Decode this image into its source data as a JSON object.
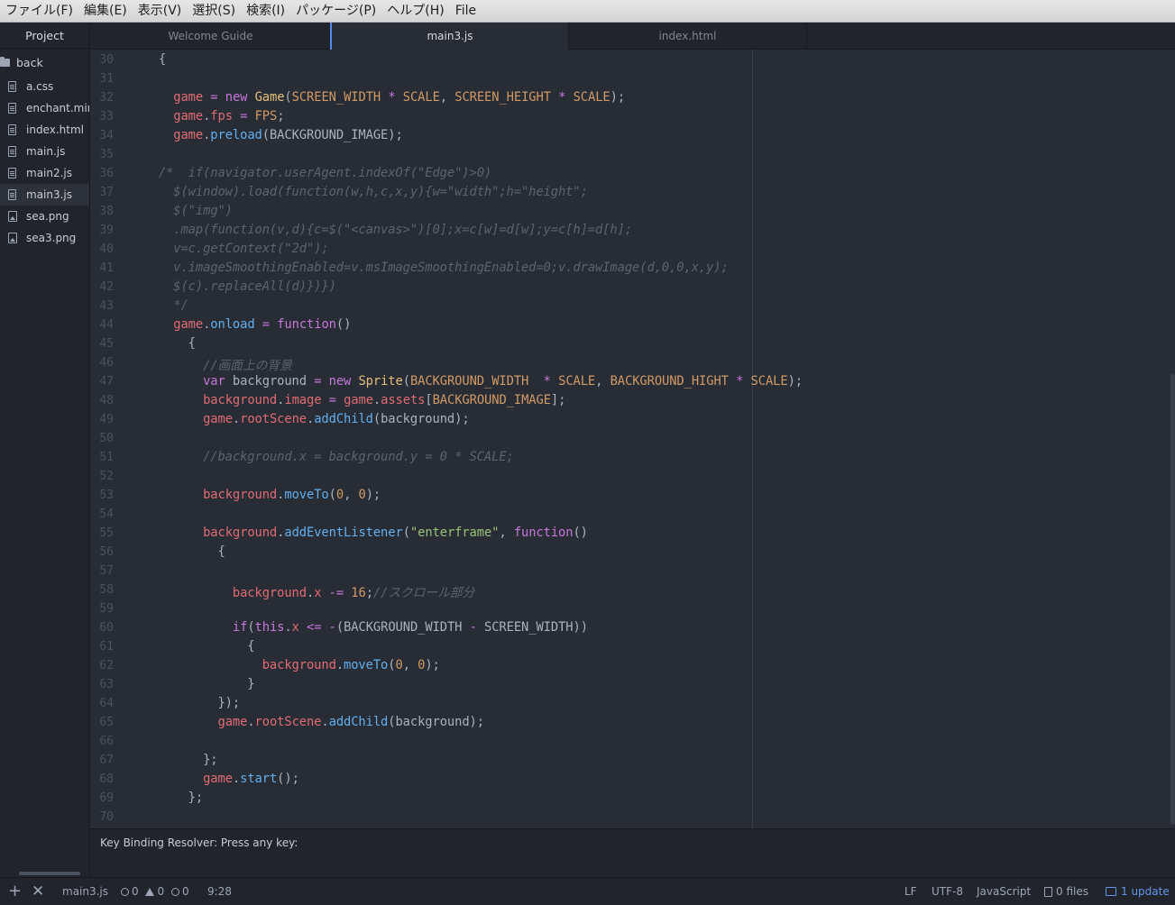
{
  "menu": [
    "ファイル(F)",
    "編集(E)",
    "表示(V)",
    "選択(S)",
    "検索(I)",
    "パッケージ(P)",
    "ヘルプ(H)",
    "File"
  ],
  "sidebar": {
    "title": "Project",
    "root": "back",
    "files": [
      {
        "name": "a.css",
        "type": "file"
      },
      {
        "name": "enchant.min.js",
        "type": "file"
      },
      {
        "name": "index.html",
        "type": "file"
      },
      {
        "name": "main.js",
        "type": "file"
      },
      {
        "name": "main2.js",
        "type": "file"
      },
      {
        "name": "main3.js",
        "type": "file",
        "selected": true
      },
      {
        "name": "sea.png",
        "type": "image"
      },
      {
        "name": "sea3.png",
        "type": "image"
      }
    ]
  },
  "tabs": [
    {
      "label": "Welcome Guide",
      "active": false
    },
    {
      "label": "main3.js",
      "active": true
    },
    {
      "label": "index.html",
      "active": false
    }
  ],
  "editor": {
    "lines": [
      {
        "n": "30",
        "tokens": [
          [
            "p",
            "    {"
          ]
        ]
      },
      {
        "n": "31",
        "tokens": []
      },
      {
        "n": "32",
        "tokens": [
          [
            "p",
            "      "
          ],
          [
            "v",
            "game"
          ],
          [
            "p",
            " "
          ],
          [
            "o",
            "="
          ],
          [
            "p",
            " "
          ],
          [
            "k",
            "new"
          ],
          [
            "p",
            " "
          ],
          [
            "t",
            "Game"
          ],
          [
            "p",
            "("
          ],
          [
            "c",
            "SCREEN_WIDTH"
          ],
          [
            "p",
            " "
          ],
          [
            "o",
            "*"
          ],
          [
            "p",
            " "
          ],
          [
            "c",
            "SCALE"
          ],
          [
            "p",
            ", "
          ],
          [
            "c",
            "SCREEN_HEIGHT"
          ],
          [
            "p",
            " "
          ],
          [
            "o",
            "*"
          ],
          [
            "p",
            " "
          ],
          [
            "c",
            "SCALE"
          ],
          [
            "p",
            ");"
          ]
        ]
      },
      {
        "n": "33",
        "tokens": [
          [
            "p",
            "      "
          ],
          [
            "v",
            "game"
          ],
          [
            "p",
            "."
          ],
          [
            "v",
            "fps"
          ],
          [
            "p",
            " "
          ],
          [
            "o",
            "="
          ],
          [
            "p",
            " "
          ],
          [
            "c",
            "FPS"
          ],
          [
            "p",
            ";"
          ]
        ]
      },
      {
        "n": "34",
        "tokens": [
          [
            "p",
            "      "
          ],
          [
            "v",
            "game"
          ],
          [
            "p",
            "."
          ],
          [
            "f",
            "preload"
          ],
          [
            "p",
            "(BACKGROUND_IMAGE);"
          ]
        ]
      },
      {
        "n": "35",
        "tokens": []
      },
      {
        "n": "36",
        "tokens": [
          [
            "m",
            "    /*  if(navigator.userAgent.indexOf(\"Edge\")>0)"
          ]
        ]
      },
      {
        "n": "37",
        "tokens": [
          [
            "m",
            "      $(window).load(function(w,h,c,x,y){w=\"width\";h=\"height\";"
          ]
        ]
      },
      {
        "n": "38",
        "tokens": [
          [
            "m",
            "      $(\"img\")"
          ]
        ]
      },
      {
        "n": "39",
        "tokens": [
          [
            "m",
            "      .map(function(v,d){c=$(\"<canvas>\")[0];x=c[w]=d[w];y=c[h]=d[h];"
          ]
        ]
      },
      {
        "n": "40",
        "tokens": [
          [
            "m",
            "      v=c.getContext(\"2d\");"
          ]
        ]
      },
      {
        "n": "41",
        "tokens": [
          [
            "m",
            "      v.imageSmoothingEnabled=v.msImageSmoothingEnabled=0;v.drawImage(d,0,0,x,y);"
          ]
        ]
      },
      {
        "n": "42",
        "tokens": [
          [
            "m",
            "      $(c).replaceAll(d)})})"
          ]
        ]
      },
      {
        "n": "43",
        "tokens": [
          [
            "m",
            "      */"
          ]
        ]
      },
      {
        "n": "44",
        "tokens": [
          [
            "p",
            "      "
          ],
          [
            "v",
            "game"
          ],
          [
            "p",
            "."
          ],
          [
            "f",
            "onload"
          ],
          [
            "p",
            " "
          ],
          [
            "o",
            "="
          ],
          [
            "p",
            " "
          ],
          [
            "k",
            "function"
          ],
          [
            "p",
            "()"
          ]
        ]
      },
      {
        "n": "45",
        "tokens": [
          [
            "p",
            "        {"
          ]
        ]
      },
      {
        "n": "46",
        "tokens": [
          [
            "m",
            "          //画面上の背景"
          ]
        ]
      },
      {
        "n": "47",
        "tokens": [
          [
            "p",
            "          "
          ],
          [
            "k",
            "var"
          ],
          [
            "p",
            " background "
          ],
          [
            "o",
            "="
          ],
          [
            "p",
            " "
          ],
          [
            "k",
            "new"
          ],
          [
            "p",
            " "
          ],
          [
            "t",
            "Sprite"
          ],
          [
            "p",
            "("
          ],
          [
            "c",
            "BACKGROUND_WIDTH"
          ],
          [
            "p",
            "  "
          ],
          [
            "o",
            "*"
          ],
          [
            "p",
            " "
          ],
          [
            "c",
            "SCALE"
          ],
          [
            "p",
            ", "
          ],
          [
            "c",
            "BACKGROUND_HIGHT"
          ],
          [
            "p",
            " "
          ],
          [
            "o",
            "*"
          ],
          [
            "p",
            " "
          ],
          [
            "c",
            "SCALE"
          ],
          [
            "p",
            ");"
          ]
        ]
      },
      {
        "n": "48",
        "tokens": [
          [
            "p",
            "          "
          ],
          [
            "v",
            "background"
          ],
          [
            "p",
            "."
          ],
          [
            "v",
            "image"
          ],
          [
            "p",
            " "
          ],
          [
            "o",
            "="
          ],
          [
            "p",
            " "
          ],
          [
            "v",
            "game"
          ],
          [
            "p",
            "."
          ],
          [
            "v",
            "assets"
          ],
          [
            "p",
            "["
          ],
          [
            "c",
            "BACKGROUND_IMAGE"
          ],
          [
            "p",
            "];"
          ]
        ]
      },
      {
        "n": "49",
        "tokens": [
          [
            "p",
            "          "
          ],
          [
            "v",
            "game"
          ],
          [
            "p",
            "."
          ],
          [
            "v",
            "rootScene"
          ],
          [
            "p",
            "."
          ],
          [
            "f",
            "addChild"
          ],
          [
            "p",
            "(background);"
          ]
        ]
      },
      {
        "n": "50",
        "tokens": []
      },
      {
        "n": "51",
        "tokens": [
          [
            "m",
            "          //background.x = background.y = 0 * SCALE;"
          ]
        ]
      },
      {
        "n": "52",
        "tokens": []
      },
      {
        "n": "53",
        "tokens": [
          [
            "p",
            "          "
          ],
          [
            "v",
            "background"
          ],
          [
            "p",
            "."
          ],
          [
            "f",
            "moveTo"
          ],
          [
            "p",
            "("
          ],
          [
            "c",
            "0"
          ],
          [
            "p",
            ", "
          ],
          [
            "c",
            "0"
          ],
          [
            "p",
            ");"
          ]
        ]
      },
      {
        "n": "54",
        "tokens": []
      },
      {
        "n": "55",
        "tokens": [
          [
            "p",
            "          "
          ],
          [
            "v",
            "background"
          ],
          [
            "p",
            "."
          ],
          [
            "f",
            "addEventListener"
          ],
          [
            "p",
            "("
          ],
          [
            "s",
            "\"enterframe\""
          ],
          [
            "p",
            ", "
          ],
          [
            "k",
            "function"
          ],
          [
            "p",
            "()"
          ]
        ]
      },
      {
        "n": "56",
        "tokens": [
          [
            "p",
            "            {"
          ]
        ]
      },
      {
        "n": "57",
        "tokens": []
      },
      {
        "n": "58",
        "tokens": [
          [
            "p",
            "              "
          ],
          [
            "v",
            "background"
          ],
          [
            "p",
            "."
          ],
          [
            "v",
            "x"
          ],
          [
            "p",
            " "
          ],
          [
            "o",
            "-="
          ],
          [
            "p",
            " "
          ],
          [
            "c",
            "16"
          ],
          [
            "p",
            ";"
          ],
          [
            "m",
            "//スクロール部分"
          ]
        ]
      },
      {
        "n": "59",
        "tokens": []
      },
      {
        "n": "60",
        "tokens": [
          [
            "p",
            "              "
          ],
          [
            "k",
            "if"
          ],
          [
            "p",
            "("
          ],
          [
            "k",
            "this"
          ],
          [
            "p",
            "."
          ],
          [
            "v",
            "x"
          ],
          [
            "p",
            " "
          ],
          [
            "o",
            "<="
          ],
          [
            "p",
            " "
          ],
          [
            "o",
            "-"
          ],
          [
            "p",
            "(BACKGROUND_WIDTH "
          ],
          [
            "o",
            "-"
          ],
          [
            "p",
            " SCREEN_WIDTH))"
          ]
        ]
      },
      {
        "n": "61",
        "tokens": [
          [
            "p",
            "                {"
          ]
        ]
      },
      {
        "n": "62",
        "tokens": [
          [
            "p",
            "                  "
          ],
          [
            "v",
            "background"
          ],
          [
            "p",
            "."
          ],
          [
            "f",
            "moveTo"
          ],
          [
            "p",
            "("
          ],
          [
            "c",
            "0"
          ],
          [
            "p",
            ", "
          ],
          [
            "c",
            "0"
          ],
          [
            "p",
            ");"
          ]
        ]
      },
      {
        "n": "63",
        "tokens": [
          [
            "p",
            "                }"
          ]
        ]
      },
      {
        "n": "64",
        "tokens": [
          [
            "p",
            "            });"
          ]
        ]
      },
      {
        "n": "65",
        "tokens": [
          [
            "p",
            "            "
          ],
          [
            "v",
            "game"
          ],
          [
            "p",
            "."
          ],
          [
            "v",
            "rootScene"
          ],
          [
            "p",
            "."
          ],
          [
            "f",
            "addChild"
          ],
          [
            "p",
            "(background);"
          ]
        ]
      },
      {
        "n": "66",
        "tokens": []
      },
      {
        "n": "67",
        "tokens": [
          [
            "p",
            "          };"
          ]
        ]
      },
      {
        "n": "68",
        "tokens": [
          [
            "p",
            "          "
          ],
          [
            "v",
            "game"
          ],
          [
            "p",
            "."
          ],
          [
            "f",
            "start"
          ],
          [
            "p",
            "();"
          ]
        ]
      },
      {
        "n": "69",
        "tokens": [
          [
            "p",
            "        };"
          ]
        ]
      },
      {
        "n": "70",
        "tokens": []
      }
    ]
  },
  "resolver": {
    "text": "Key Binding Resolver: Press any key:"
  },
  "status": {
    "filename": "main3.js",
    "errors": "0",
    "warnings": "0",
    "infos": "0",
    "cursor": "9:28",
    "line_ending": "LF",
    "encoding": "UTF-8",
    "grammar": "JavaScript",
    "git_files": "0 files",
    "updates": "1 update"
  }
}
